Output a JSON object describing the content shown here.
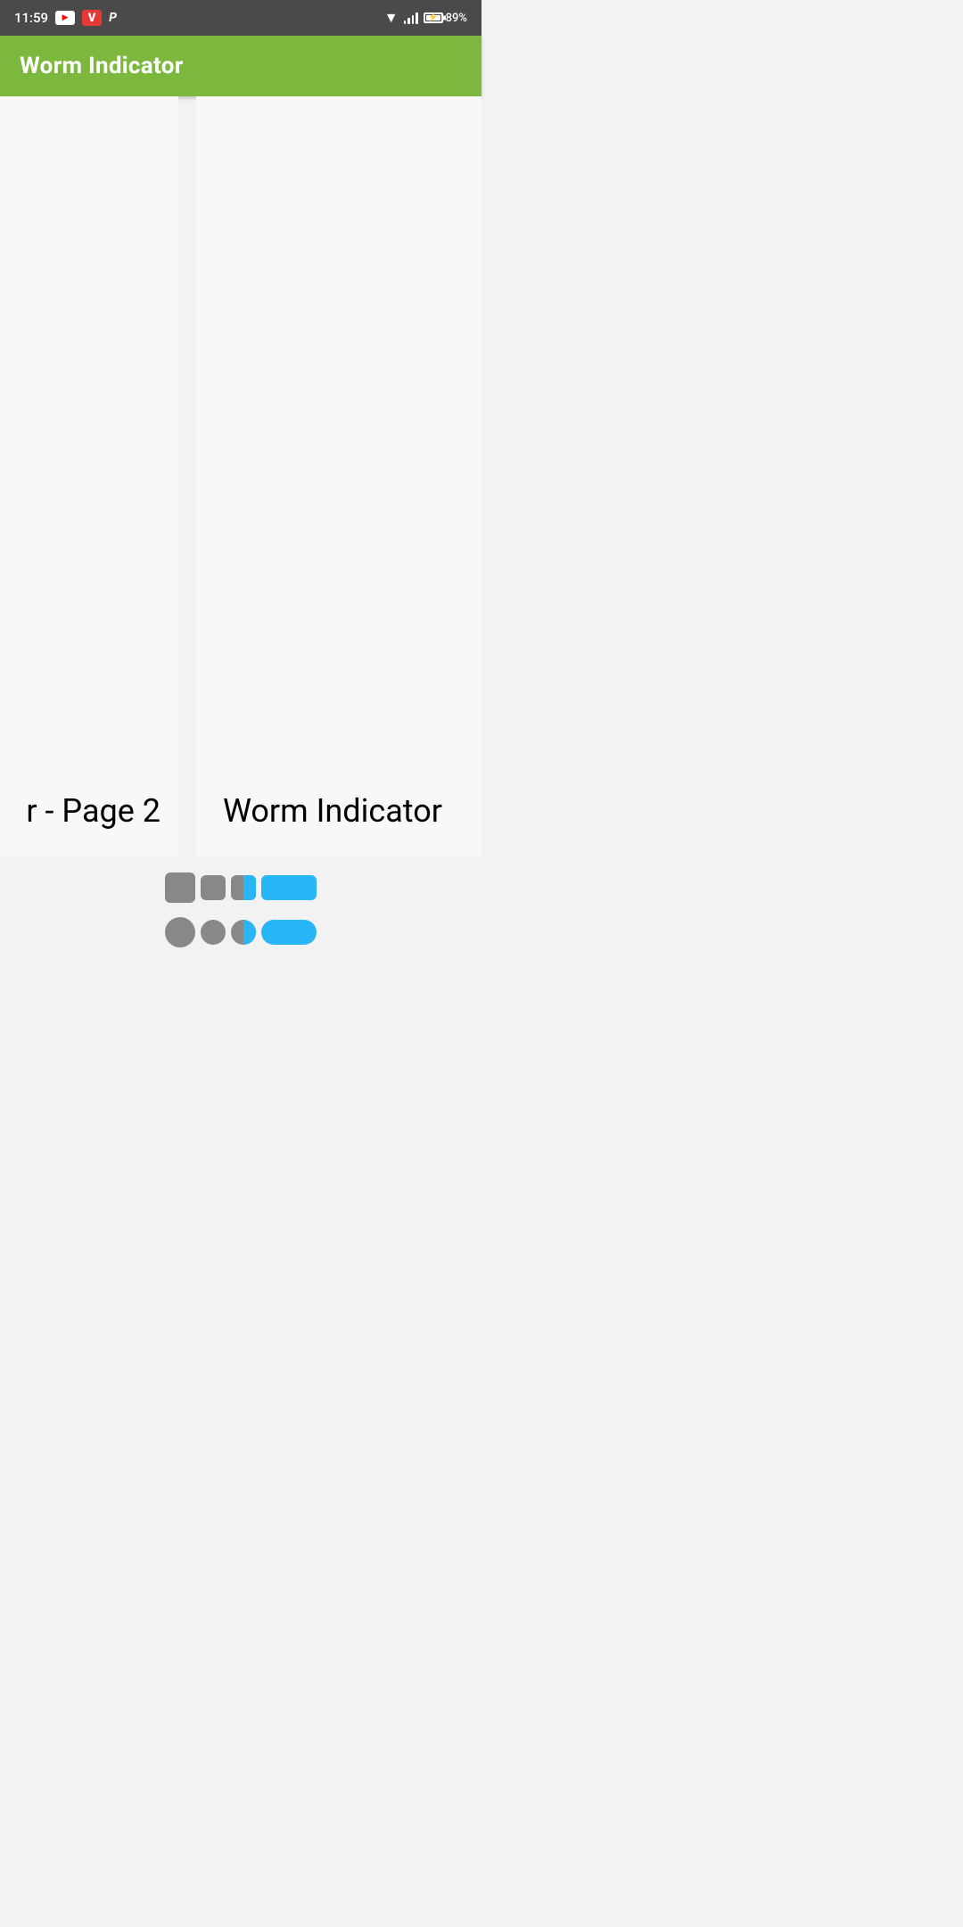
{
  "status_bar": {
    "time": "11:59",
    "battery_percent": "89%",
    "icons": {
      "youtube": "▶",
      "v_label": "V",
      "p_label": "P"
    },
    "colors": {
      "background": "#4a4a4a",
      "youtube_bg": "#ffffff",
      "v_bg": "#e53935",
      "text": "#ffffff"
    }
  },
  "app_bar": {
    "title": "Worm Indicator",
    "background_color": "#7cb83e",
    "text_color": "#ffffff"
  },
  "content": {
    "page_left_label": "r - Page 2",
    "page_right_label": "Worm Indicator"
  },
  "indicators": {
    "rect_row": {
      "item1_label": "rect-inactive-large",
      "item2_label": "rect-inactive-small",
      "item3_label": "rect-half-active",
      "item4_label": "rect-active-pill"
    },
    "circle_row": {
      "item1_label": "circle-inactive-large",
      "item2_label": "circle-inactive-small",
      "item3_label": "circle-half-active",
      "item4_label": "circle-active-pill"
    },
    "active_color": "#29b6f6",
    "inactive_color": "#888888"
  }
}
